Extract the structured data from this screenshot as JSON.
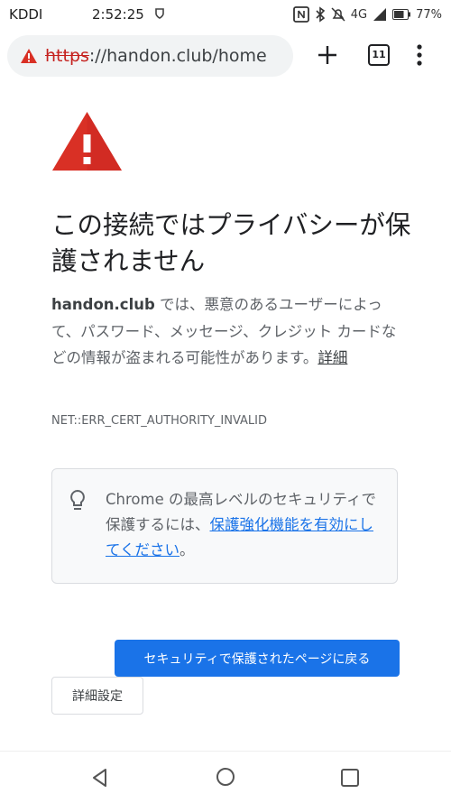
{
  "status_bar": {
    "carrier": "KDDI",
    "time": "2:52:25",
    "network": "4G",
    "battery": "77%",
    "icons": [
      "nfc-icon",
      "bluetooth-icon",
      "mute-icon",
      "signal-icon",
      "battery-icon"
    ]
  },
  "toolbar": {
    "url_scheme": "https",
    "url_rest": "://handon.club/home",
    "tab_count": "11",
    "icons": [
      "warning-icon",
      "plus-icon",
      "tab-switcher-icon",
      "more-menu-icon"
    ]
  },
  "interstitial": {
    "heading": "この接続ではプライバシーが保護されません",
    "domain": "handon.club",
    "body": " では、悪意のあるユーザーによって、パスワード、メッセージ、クレジット カードなどの情報が盗まれる可能性があります。",
    "details_link": "詳細",
    "error_code": "NET::ERR_CERT_AUTHORITY_INVALID",
    "tip_prefix": "Chrome の最高レベルのセキュリティで保護するには、",
    "tip_link": "保護強化機能を有効にしてください",
    "tip_suffix": "。",
    "primary_button": "セキュリティで保護されたページに戻る",
    "secondary_button": "詳細設定"
  },
  "colors": {
    "accent": "#1a73e8",
    "danger": "#d93025"
  }
}
